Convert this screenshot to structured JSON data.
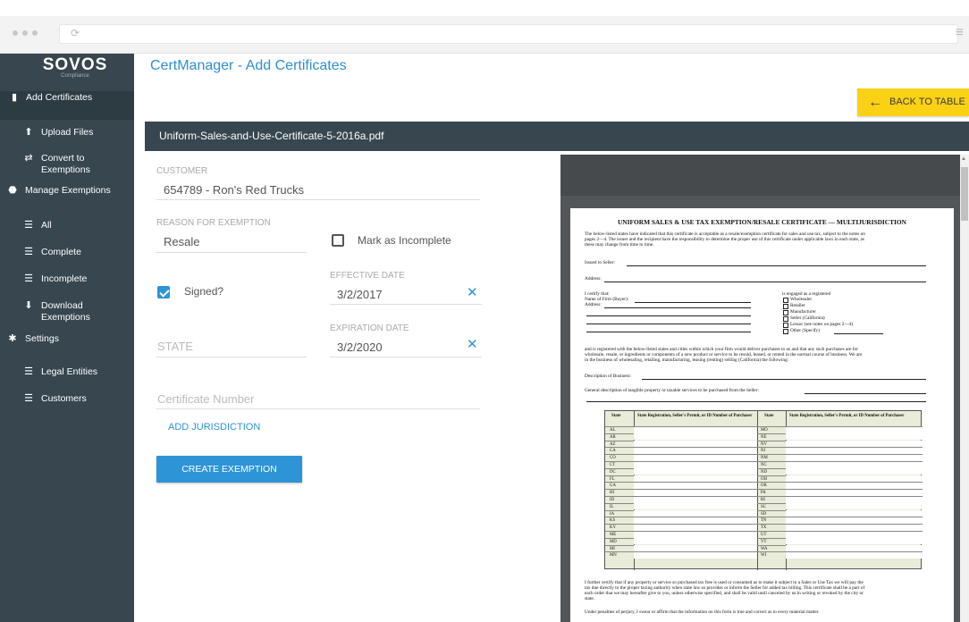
{
  "browser": {
    "reload_glyph": "⟳",
    "menu_glyph": "≡"
  },
  "brand": {
    "name": "SOVOS",
    "sub": "Compliance"
  },
  "sidebar": {
    "items": [
      {
        "label": "Add Certificates",
        "icon": "add-certificate-icon",
        "glyph": "▮"
      },
      {
        "label": "Upload Files",
        "icon": "upload-icon",
        "glyph": "⬆"
      },
      {
        "label": "Convert to Exemptions",
        "icon": "convert-icon",
        "glyph": "⇄"
      },
      {
        "label": "Manage Exemptions",
        "icon": "manage-exemptions-icon",
        "glyph": "⬣"
      },
      {
        "label": "All",
        "icon": "list-icon",
        "glyph": "☰"
      },
      {
        "label": "Complete",
        "icon": "list-icon",
        "glyph": "☰"
      },
      {
        "label": "Incomplete",
        "icon": "list-icon",
        "glyph": "☰"
      },
      {
        "label": "Download Exemptions",
        "icon": "download-icon",
        "glyph": "⬇"
      },
      {
        "label": "Settings",
        "icon": "gear-icon",
        "glyph": "✱"
      },
      {
        "label": "Legal Entities",
        "icon": "list-icon",
        "glyph": "☰"
      },
      {
        "label": "Customers",
        "icon": "list-icon",
        "glyph": "☰"
      }
    ]
  },
  "header": {
    "title": "CertManager - Add Certificates",
    "back_label": "BACK TO TABLE",
    "back_glyph": "←"
  },
  "file": {
    "name": "Uniform-Sales-and-Use-Certificate-5-2016a.pdf"
  },
  "form": {
    "customer_label": "CUSTOMER",
    "customer_value": "654789 - Ron's Red Trucks",
    "reason_label": "REASON FOR EXEMPTION",
    "reason_value": "Resale",
    "incomplete_label": "Mark as Incomplete",
    "incomplete_checked": false,
    "signed_label": "Signed?",
    "signed_checked": true,
    "effective_label": "EFFECTIVE DATE",
    "effective_value": "3/2/2017",
    "expiration_label": "EXPIRATION DATE",
    "expiration_value": "3/2/2020",
    "state_placeholder": "STATE",
    "cert_placeholder": "Certificate Number",
    "clear_glyph": "✕",
    "add_jurisdiction": "ADD JURISDICTION",
    "create_button": "CREATE EXEMPTION"
  },
  "document": {
    "title": "UNIFORM SALES & USE TAX EXEMPTION/RESALE CERTIFICATE — MULTIJURISDICTION",
    "intro1": "The below-listed states have indicated that this certificate is acceptable as a resale/exemption certificate for sales and use tax, subject to the notes on",
    "intro2": "pages 2—4. The issuer and the recipient have the responsibility to determine the proper use of this certificate under applicable laws in each state, as",
    "intro3": "these may change from time to time.",
    "issued": "Issued to Seller:",
    "address": "Address:",
    "certify": "I certify that:",
    "firm": "Name of Firm (Buyer):",
    "addr2": "Address:",
    "engaged": "is engaged as a registered",
    "options": [
      "Wholesaler",
      "Retailer",
      "Manufacturer",
      "Seller (California)",
      "Lessor (see notes on pages 2—4)",
      "Other (Specify)"
    ],
    "reg1": "and is registered with the below-listed states and cities within which your firm would deliver purchases to us and that any such purchases are for",
    "reg2": "wholesale, resale, or ingredients or components of a new product or service to be resold, leased, or rented in the normal course of business. We are",
    "reg3": "in the business of wholesaling, retailing, manufacturing, leasing (renting) selling (California) the following:",
    "desc": "Description of Business:",
    "general": "General description of tangible property or taxable services to be purchased from the Seller:",
    "th_state": "State",
    "th_reg": "State Registration, Seller's Permit, or ID Number of Purchaser",
    "left_states": [
      "AL",
      "AR",
      "AZ",
      "CA",
      "CO",
      "CT",
      "DC",
      "FL",
      "GA",
      "HI",
      "ID",
      "IL",
      "IA",
      "KS",
      "KY",
      "ME",
      "MD",
      "MI",
      "MN"
    ],
    "right_states": [
      "MO",
      "NE",
      "NV",
      "NJ",
      "NM",
      "NC",
      "ND",
      "OH",
      "OK",
      "PA",
      "RI",
      "SC",
      "SD",
      "TN",
      "TX",
      "UT",
      "VT",
      "WA",
      "WI"
    ],
    "further1": "I further certify that if any property or service so purchased tax free is used or consumed as to make it subject to a Sales or Use Tax we will pay the",
    "further2": "tax due directly to the proper taxing authority when state law so provides or inform the Seller for added tax billing. This certificate shall be a part of",
    "further3": "each order that we may hereafter give to you, unless otherwise specified, and shall be valid until canceled by us in writing or revoked by the city or",
    "further4": "state.",
    "perjury": "Under penalties of perjury, I swear or affirm that the information on this form is true and correct as to every material matter."
  }
}
